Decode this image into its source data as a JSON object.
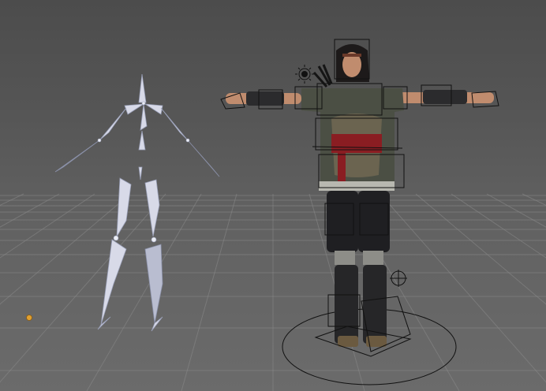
{
  "viewport": {
    "background_top": "#4c4c4c",
    "background_bottom": "#6b6b6b",
    "grid_color": "#8a8a8a"
  },
  "scene": {
    "objects": [
      "armature-skeleton",
      "rigged-character"
    ],
    "icons": [
      "light-icon",
      "target-locator-icon",
      "origin-point-icon"
    ],
    "colors": {
      "bone": "#d8dae8",
      "outfit_green": "#4b4f44",
      "sash_red": "#8a1d22",
      "skin": "#c08c6e",
      "hair": "#1d1a1a",
      "origin_point": "#e0a030"
    }
  }
}
